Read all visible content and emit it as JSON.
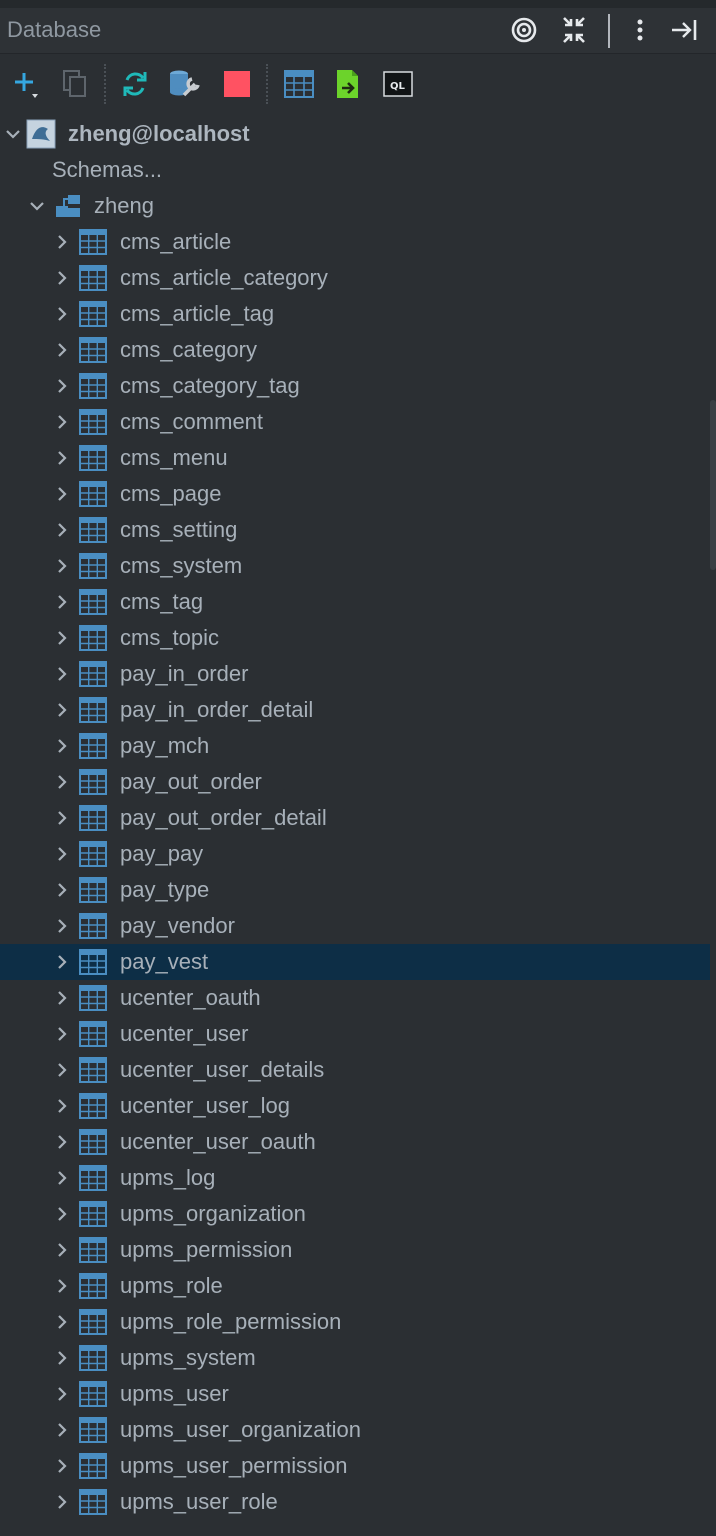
{
  "panel": {
    "title": "Database"
  },
  "title_icons": [
    "target-icon",
    "collapse-icon",
    "more-vertical-icon",
    "hide-panel-icon"
  ],
  "toolbar_icons": [
    "add-icon",
    "duplicate-icon",
    "refresh-icon",
    "properties-icon",
    "stop-icon",
    "table-view-icon",
    "jump-to-source-icon",
    "console-icon"
  ],
  "tree": {
    "host": "zheng@localhost",
    "schemas_label": "Schemas...",
    "schema": "zheng",
    "selected_table": "pay_vest",
    "tables": [
      "cms_article",
      "cms_article_category",
      "cms_article_tag",
      "cms_category",
      "cms_category_tag",
      "cms_comment",
      "cms_menu",
      "cms_page",
      "cms_setting",
      "cms_system",
      "cms_tag",
      "cms_topic",
      "pay_in_order",
      "pay_in_order_detail",
      "pay_mch",
      "pay_out_order",
      "pay_out_order_detail",
      "pay_pay",
      "pay_type",
      "pay_vendor",
      "pay_vest",
      "ucenter_oauth",
      "ucenter_user",
      "ucenter_user_details",
      "ucenter_user_log",
      "ucenter_user_oauth",
      "upms_log",
      "upms_organization",
      "upms_permission",
      "upms_role",
      "upms_role_permission",
      "upms_system",
      "upms_user",
      "upms_user_organization",
      "upms_user_permission",
      "upms_user_role"
    ]
  },
  "colors": {
    "background": "#2b2f33",
    "selection": "#0d2e46",
    "table_icon": "#4a8ec2",
    "text": "#a7b0b9",
    "stop": "#ff5262",
    "green": "#6cd32b"
  }
}
